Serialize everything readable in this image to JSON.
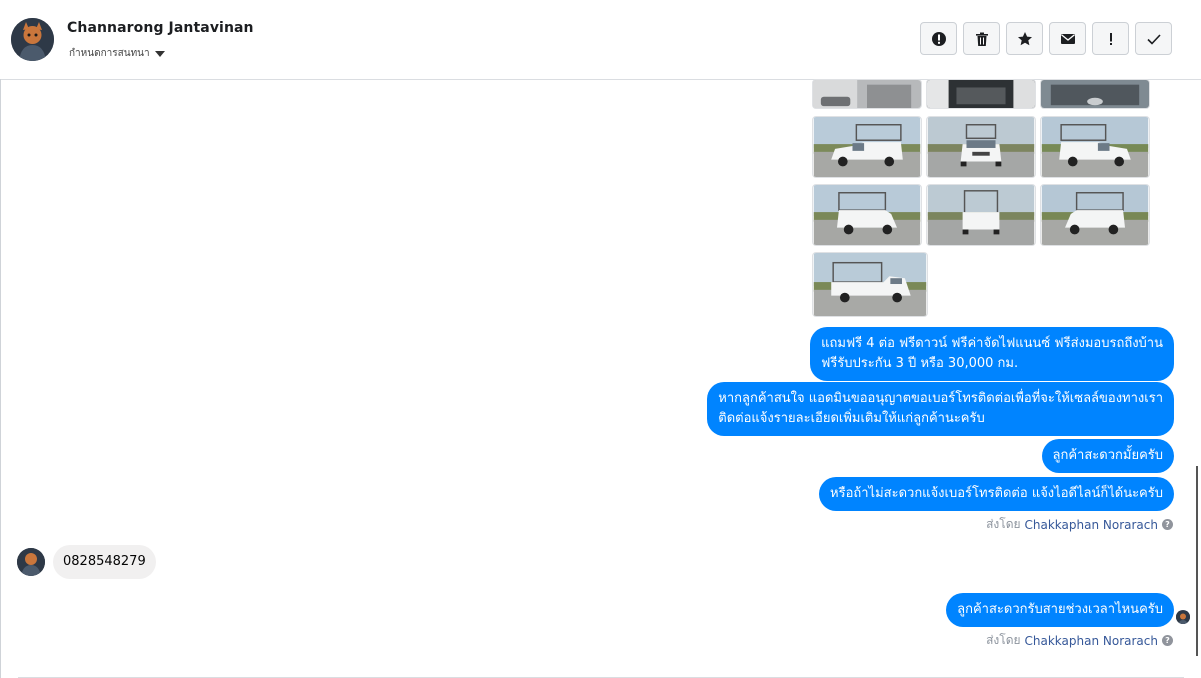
{
  "header": {
    "contact_name": "Channarong Jantavinan",
    "assign_label": "กำหนดการสนทนา"
  },
  "toolbar": {
    "buttons": [
      {
        "icon": "alert-circle-icon"
      },
      {
        "icon": "trash-icon"
      },
      {
        "icon": "star-icon"
      },
      {
        "icon": "envelope-icon"
      },
      {
        "icon": "exclamation-icon"
      },
      {
        "icon": "check-icon"
      }
    ]
  },
  "photos": {
    "count": 10,
    "description": [
      "pickup-truck-interior",
      "pickup-truck-cabin",
      "pickup-truck-engine",
      "pickup-truck-front-left",
      "pickup-truck-front",
      "pickup-truck-front-right",
      "pickup-truck-rear-left",
      "pickup-truck-rear",
      "pickup-truck-rear-right",
      "pickup-truck-side"
    ]
  },
  "messages": {
    "m1_line1": "แถมฟรี 4 ต่อ ฟรีดาวน์ ฟรีค่าจัดไฟแนนซ์ ฟรีส่งมอบรถถึงบ้าน",
    "m1_line2": "ฟรีรับประกัน 3 ปี หรือ 30,000 กม.",
    "m2_line1": "หากลูกค้าสนใจ แอดมินขออนุญาตขอเบอร์โทรติดต่อเพื่อที่จะให้เซลล์ของทางเรา",
    "m2_line2": "ติดต่อแจ้งรายละเอียดเพิ่มเติมให้แก่ลูกค้านะครับ",
    "m3": "ลูกค้าสะดวกมั้ยครับ",
    "m4": "หรือถ้าไม่สะดวกแจ้งเบอร์โทรติดต่อ แจ้งไอดีไลน์ก็ได้นะครับ",
    "incoming": "0828548279",
    "m5": "ลูกค้าสะดวกรับสายช่วงเวลาไหนครับ"
  },
  "sent_by": {
    "prefix": "ส่งโดย",
    "agent": "Chakkaphan Norarach",
    "help": "?"
  },
  "colors": {
    "outgoing_bubble": "#0084ff",
    "incoming_bubble": "#f1f0f0",
    "agent_link": "#365899"
  }
}
